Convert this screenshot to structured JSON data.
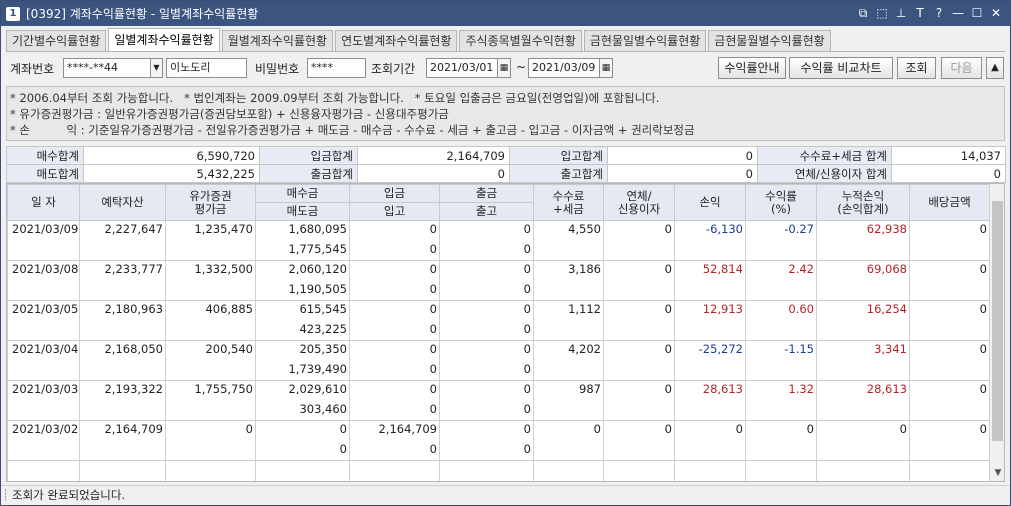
{
  "window": {
    "number": "1",
    "title": "[0392] 계좌수익률현황 - 일별계좌수익률현황",
    "controls": [
      "⧉",
      "⬚",
      "⊥",
      "T",
      "?",
      "—",
      "☐",
      "✕"
    ]
  },
  "tabs": [
    {
      "label": "기간별수익률현황",
      "active": false
    },
    {
      "label": "일별계좌수익률현황",
      "active": true
    },
    {
      "label": "월별계좌수익률현황",
      "active": false
    },
    {
      "label": "연도별계좌수익률현황",
      "active": false
    },
    {
      "label": "주식종목별월수익현황",
      "active": false
    },
    {
      "label": "금현물일별수익률현황",
      "active": false
    },
    {
      "label": "금현물월별수익률현황",
      "active": false
    }
  ],
  "search": {
    "account_label": "계좌번호",
    "account_value": "****-**44",
    "account_name": "이노도리",
    "password_label": "비밀번호",
    "password_value": "****",
    "period_label": "조회기간",
    "date_from": "2021/03/01",
    "tilde": "~",
    "date_to": "2021/03/09",
    "btn_guide": "수익률안내",
    "btn_compare": "수익률 비교차트",
    "btn_query": "조회",
    "btn_next": "다음",
    "btn_up": "▲"
  },
  "notes": [
    "* 2006.04부터 조회 가능합니다.   * 법인계좌는 2009.09부터 조회 가능합니다.   * 토요일 입출금은 금요일(전영업일)에 포함됩니다.",
    "* 유가증권평가금 : 일반유가증권평가금(증권담보포함) + 신용융자평가금 - 신용대주평가금",
    "* 손          익 : 기준일유가증권평가금 - 전일유가증권평가금 + 매도금 - 매수금 - 수수료 - 세금 + 출고금 - 입고금 - 이자금액 + 권리락보정금"
  ],
  "summary": {
    "buy_total_label": "매수합계",
    "buy_total": "6,590,720",
    "deposit_total_label": "입금합계",
    "deposit_total": "2,164,709",
    "in_total_label": "입고합계",
    "in_total": "0",
    "fee_total_label": "수수료+세금 합계",
    "fee_total": "14,037",
    "sell_total_label": "매도합계",
    "sell_total": "5,432,225",
    "withdraw_total_label": "출금합계",
    "withdraw_total": "0",
    "out_total_label": "출고합계",
    "out_total": "0",
    "interest_total_label": "연체/신용이자 합계",
    "interest_total": "0"
  },
  "grid": {
    "headers": {
      "date": "일 자",
      "deposit_assets": "예탁자산",
      "securities": "유가증권\n평가금",
      "buy": "매수금",
      "sell": "매도금",
      "deposit": "입금",
      "in": "입고",
      "withdraw": "출금",
      "out": "출고",
      "fee": "수수료\n+세금",
      "interest": "연체/\n신용이자",
      "pnl": "손익",
      "return": "수익률\n(%)",
      "cum_pnl": "누적손익\n(손익합계)",
      "dividend": "배당금액"
    },
    "rows": [
      {
        "date": "2021/03/09",
        "assets": "2,227,647",
        "securities": "1,235,470",
        "buy": "1,680,095",
        "sell": "1,775,545",
        "deposit": "0",
        "in": "0",
        "withdraw": "0",
        "out": "0",
        "fee": "4,550",
        "interest": "0",
        "pnl": "-6,130",
        "ret": "-0.27",
        "cum": "62,938",
        "div": "0",
        "sign": "neg",
        "cum_sign": "pos"
      },
      {
        "date": "2021/03/08",
        "assets": "2,233,777",
        "securities": "1,332,500",
        "buy": "2,060,120",
        "sell": "1,190,505",
        "deposit": "0",
        "in": "0",
        "withdraw": "0",
        "out": "0",
        "fee": "3,186",
        "interest": "0",
        "pnl": "52,814",
        "ret": "2.42",
        "cum": "69,068",
        "div": "0",
        "sign": "pos",
        "cum_sign": "pos"
      },
      {
        "date": "2021/03/05",
        "assets": "2,180,963",
        "securities": "406,885",
        "buy": "615,545",
        "sell": "423,225",
        "deposit": "0",
        "in": "0",
        "withdraw": "0",
        "out": "0",
        "fee": "1,112",
        "interest": "0",
        "pnl": "12,913",
        "ret": "0.60",
        "cum": "16,254",
        "div": "0",
        "sign": "pos",
        "cum_sign": "pos"
      },
      {
        "date": "2021/03/04",
        "assets": "2,168,050",
        "securities": "200,540",
        "buy": "205,350",
        "sell": "1,739,490",
        "deposit": "0",
        "in": "0",
        "withdraw": "0",
        "out": "0",
        "fee": "4,202",
        "interest": "0",
        "pnl": "-25,272",
        "ret": "-1.15",
        "cum": "3,341",
        "div": "0",
        "sign": "neg",
        "cum_sign": "pos"
      },
      {
        "date": "2021/03/03",
        "assets": "2,193,322",
        "securities": "1,755,750",
        "buy": "2,029,610",
        "sell": "303,460",
        "deposit": "0",
        "in": "0",
        "withdraw": "0",
        "out": "0",
        "fee": "987",
        "interest": "0",
        "pnl": "28,613",
        "ret": "1.32",
        "cum": "28,613",
        "div": "0",
        "sign": "pos",
        "cum_sign": "pos"
      },
      {
        "date": "2021/03/02",
        "assets": "2,164,709",
        "securities": "0",
        "buy": "0",
        "sell": "0",
        "deposit": "2,164,709",
        "in": "0",
        "withdraw": "0",
        "out": "0",
        "fee": "0",
        "interest": "0",
        "pnl": "0",
        "ret": "0",
        "cum": "0",
        "div": "0",
        "sign": "",
        "cum_sign": ""
      }
    ]
  },
  "status": {
    "message": "조회가 완료되었습니다."
  },
  "colors": {
    "negative": "#1c3e8a",
    "positive": "#b3242a",
    "titlebar": "#3b5480"
  }
}
